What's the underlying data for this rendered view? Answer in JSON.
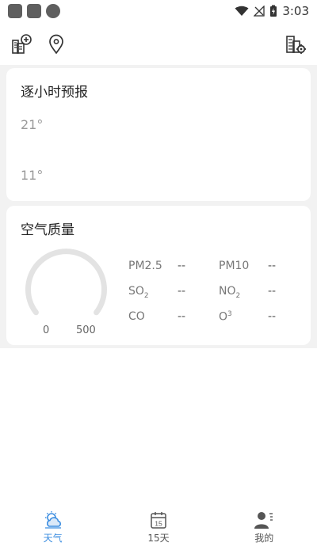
{
  "status_bar": {
    "time": "3:03"
  },
  "toolbar": {
    "add_city_icon": "city-add-icon",
    "location_icon": "location-pin-icon",
    "city_settings_icon": "city-settings-icon"
  },
  "hourly": {
    "title": "逐小时预报",
    "high": "21°",
    "low": "11°"
  },
  "air_quality": {
    "title": "空气质量",
    "gauge_min": "0",
    "gauge_max": "500",
    "items": [
      {
        "label": "PM2.5",
        "value": "--"
      },
      {
        "label": "PM10",
        "value": "--"
      },
      {
        "label_main": "SO",
        "label_sub": "2",
        "value": "--"
      },
      {
        "label_main": "NO",
        "label_sub": "2",
        "value": "--"
      },
      {
        "label": "CO",
        "value": "--"
      },
      {
        "label_main": "O",
        "label_sup": "3",
        "value": "--"
      }
    ]
  },
  "bottom_nav": {
    "items": [
      {
        "label": "天气",
        "icon": "weather-icon",
        "active": true
      },
      {
        "label": "15天",
        "icon": "calendar-15-icon",
        "calendar_number": "15",
        "active": false
      },
      {
        "label": "我的",
        "icon": "user-icon",
        "active": false
      }
    ]
  },
  "colors": {
    "accent": "#3b8de0",
    "background": "#f2f2f2",
    "card": "#ffffff"
  }
}
